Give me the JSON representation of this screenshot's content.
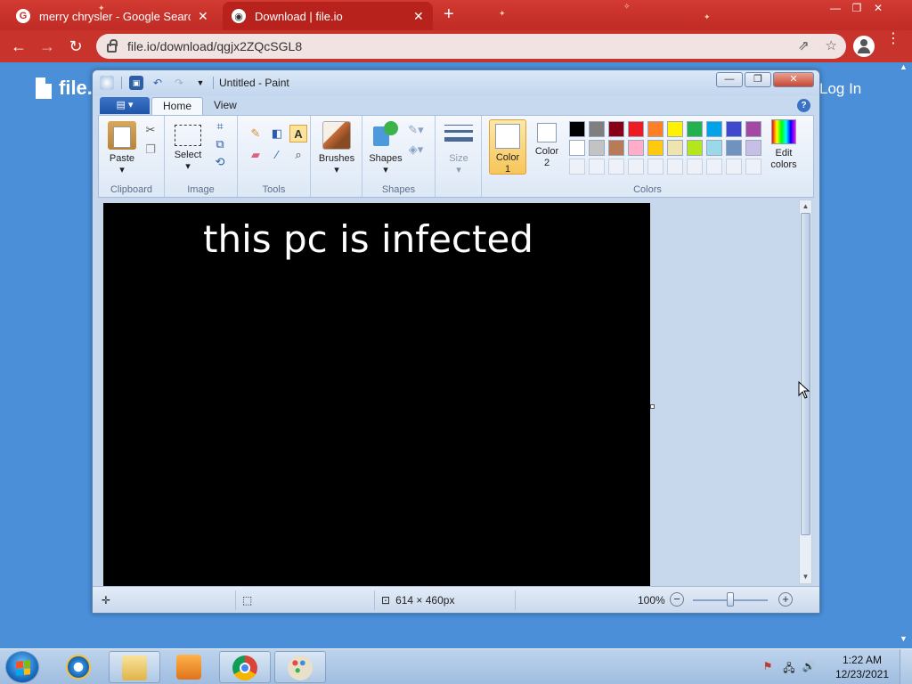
{
  "browser": {
    "tabs": [
      {
        "title": "merry chrysler - Google Search",
        "icon": "google-icon",
        "active": false
      },
      {
        "title": "Download | file.io",
        "icon": "fileio-icon",
        "active": true
      }
    ],
    "url": "file.io/download/qgjx2ZQcSGL8",
    "accent": "#c8332c"
  },
  "page": {
    "logo_text": "file.",
    "login_label": "Log In",
    "background": "#4a8fd8"
  },
  "paint": {
    "title": "Untitled - Paint",
    "tabs": [
      "Home",
      "View"
    ],
    "groups": {
      "clipboard": {
        "label": "Clipboard",
        "paste_label": "Paste"
      },
      "image": {
        "label": "Image",
        "select_label": "Select"
      },
      "tools": {
        "label": "Tools"
      },
      "brushes_label": "Brushes",
      "shapes": {
        "label": "Shapes",
        "shapes_label": "Shapes"
      },
      "size_label": "Size",
      "colors": {
        "label": "Colors",
        "color1_label": "Color",
        "color1_num": "1",
        "color2_label": "Color",
        "color2_num": "2",
        "edit_label": "Edit",
        "edit_label2": "colors",
        "palette_row1": [
          "#000000",
          "#7f7f7f",
          "#880015",
          "#ed1c24",
          "#ff7f27",
          "#fff200",
          "#22b14c",
          "#00a2e8",
          "#3f48cc",
          "#a349a4"
        ],
        "palette_row2": [
          "#ffffff",
          "#c3c3c3",
          "#b97a57",
          "#ffaec9",
          "#ffc90e",
          "#efe4b0",
          "#b5e61d",
          "#99d9ea",
          "#7092be",
          "#c8bfe7"
        ]
      }
    },
    "canvas_text": "this pc is infected",
    "canvas_color": "#000000",
    "status": {
      "dimensions": "614 × 460px",
      "zoom": "100%"
    }
  },
  "taskbar": {
    "time": "1:22 AM",
    "date": "12/23/2021",
    "pinned": [
      "ie-icon",
      "explorer-icon",
      "media-player-icon",
      "chrome-icon",
      "paint-icon"
    ]
  }
}
